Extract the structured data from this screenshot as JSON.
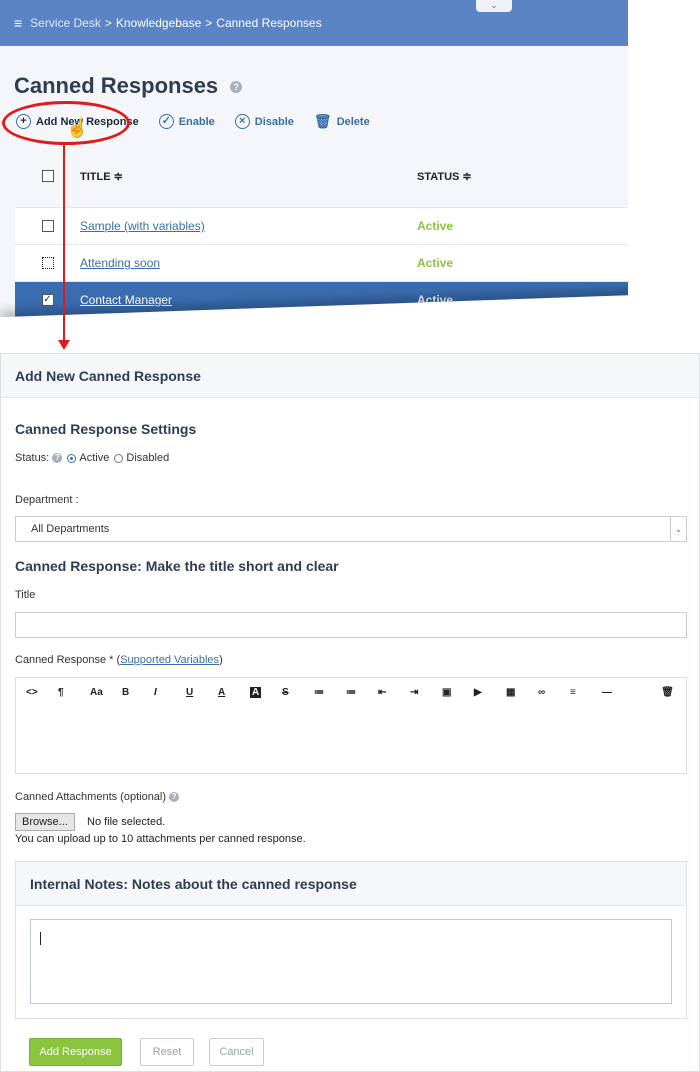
{
  "breadcrumb": {
    "menu_icon": "≡",
    "items": [
      "Service Desk",
      "Knowledgebase",
      "Canned Responses"
    ],
    "separator": ">"
  },
  "collapse_icon": "⌄",
  "page": {
    "title": "Canned Responses",
    "help": "?"
  },
  "toolbar": {
    "add": "Add New Response",
    "enable": "Enable",
    "disable": "Disable",
    "delete": "Delete"
  },
  "table": {
    "headers": {
      "title": "TITLE ≑",
      "status": "STATUS ≑"
    },
    "rows": [
      {
        "title": "Sample (with variables)",
        "status": "Active",
        "checked": false
      },
      {
        "title": "Attending soon",
        "status": "Active",
        "checked": false
      },
      {
        "title": "Contact Manager",
        "status": "Active",
        "checked": true
      }
    ]
  },
  "form": {
    "panel_title": "Add New Canned Response",
    "settings_title": "Canned Response Settings",
    "status_label": "Status:",
    "status_options": [
      "Active",
      "Disabled"
    ],
    "status_selected": "Active",
    "department_label": "Department :",
    "department_value": "All Departments",
    "title_section": "Canned Response: Make the title short and clear",
    "title_label": "Title",
    "title_value": "",
    "response_label": "Canned Response * (",
    "response_link": "Supported Variables",
    "response_label_end": ")",
    "editor_tools": [
      "<>",
      "¶",
      "Aa",
      "B",
      "I",
      "U",
      "A",
      "A",
      "S",
      "≔",
      "≔",
      "⇤",
      "⇥",
      "▣",
      "▶",
      "▦",
      "∞",
      "≡",
      "—"
    ],
    "editor_trash": "🗑",
    "attachments_label": "Canned Attachments (optional)",
    "browse_label": "Browse...",
    "no_file": "No file selected.",
    "upload_note": "You can upload up to 10 attachments per canned response.",
    "notes_title": "Internal Notes: Notes about the canned response",
    "buttons": {
      "add": "Add Response",
      "reset": "Reset",
      "cancel": "Cancel"
    }
  },
  "colors": {
    "header_blue": "#5b84c6",
    "selected_row": "#3a6db0",
    "active_green": "#8bc43f",
    "link_blue": "#3b6ea8",
    "annotation_red": "#e11a1a"
  }
}
